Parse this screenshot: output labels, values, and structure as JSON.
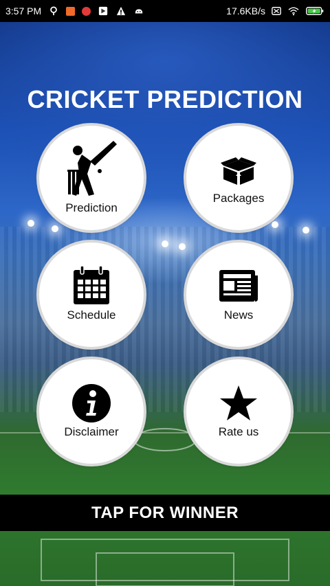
{
  "status_bar": {
    "time": "3:57 PM",
    "network_speed": "17.6KB/s",
    "left_icons": [
      "location-pin-icon",
      "mi-app-icon",
      "red-circle-app-icon",
      "play-store-icon",
      "warning-icon",
      "android-icon"
    ],
    "right_icons": [
      "no-sim-icon",
      "wifi-icon",
      "battery-charging-icon"
    ]
  },
  "app": {
    "title": "CRICKET PREDICTION",
    "accent_color": "#000000",
    "tiles": [
      {
        "label": "Prediction",
        "icon": "cricket-batsman-icon"
      },
      {
        "label": "Packages",
        "icon": "package-box-icon"
      },
      {
        "label": "Schedule",
        "icon": "calendar-icon"
      },
      {
        "label": "News",
        "icon": "newspaper-icon"
      },
      {
        "label": "Disclaimer",
        "icon": "info-icon"
      },
      {
        "label": "Rate us",
        "icon": "star-icon"
      }
    ],
    "winner_button": "TAP FOR WINNER"
  }
}
